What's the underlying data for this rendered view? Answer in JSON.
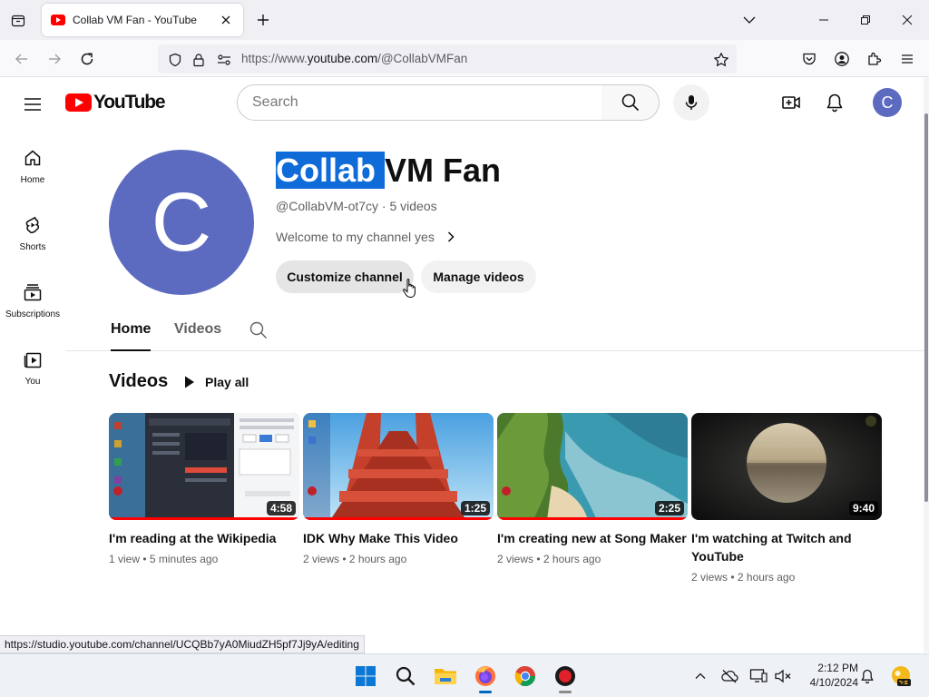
{
  "browser": {
    "tab_title": "Collab VM Fan - YouTube",
    "url_prefix": "https://www.",
    "url_host": "youtube.com",
    "url_path": "/@CollabVMFan",
    "status_url": "https://studio.youtube.com/channel/UCQBb7yA0MiudZH5pf7Jj9yA/editing"
  },
  "youtube": {
    "logo_text": "YouTube",
    "search_placeholder": "Search",
    "account_initial": "C",
    "guide": [
      {
        "label": "Home",
        "icon": "home-icon"
      },
      {
        "label": "Shorts",
        "icon": "shorts-icon"
      },
      {
        "label": "Subscriptions",
        "icon": "subscriptions-icon"
      },
      {
        "label": "You",
        "icon": "you-icon"
      }
    ]
  },
  "channel": {
    "avatar_initial": "C",
    "name_selected": "Collab ",
    "name_rest": "VM Fan",
    "meta": "@CollabVM-ot7cy · 5 videos",
    "description": "Welcome to my channel yes",
    "customize_label": "Customize channel",
    "manage_label": "Manage videos",
    "tabs": [
      "Home",
      "Videos"
    ],
    "section_title": "Videos",
    "play_all": "Play all"
  },
  "videos": [
    {
      "title": "I'm reading at the Wikipedia",
      "meta": "1 view • 5 minutes ago",
      "duration": "4:58",
      "watched": true
    },
    {
      "title": "IDK Why Make This Video",
      "meta": "2 views • 2 hours ago",
      "duration": "1:25",
      "watched": true
    },
    {
      "title": "I'm creating new at Song Maker",
      "meta": "2 views • 2 hours ago",
      "duration": "2:25",
      "watched": true
    },
    {
      "title": "I'm watching at Twitch and YouTube",
      "meta": "2 views • 2 hours ago",
      "duration": "9:40",
      "watched": false
    }
  ],
  "taskbar": {
    "time": "2:12 PM",
    "date": "4/10/2024"
  },
  "colors": {
    "brand_red": "#ff0000",
    "avatar_bg": "#5c6bc0",
    "selection": "#0f6bd7"
  }
}
